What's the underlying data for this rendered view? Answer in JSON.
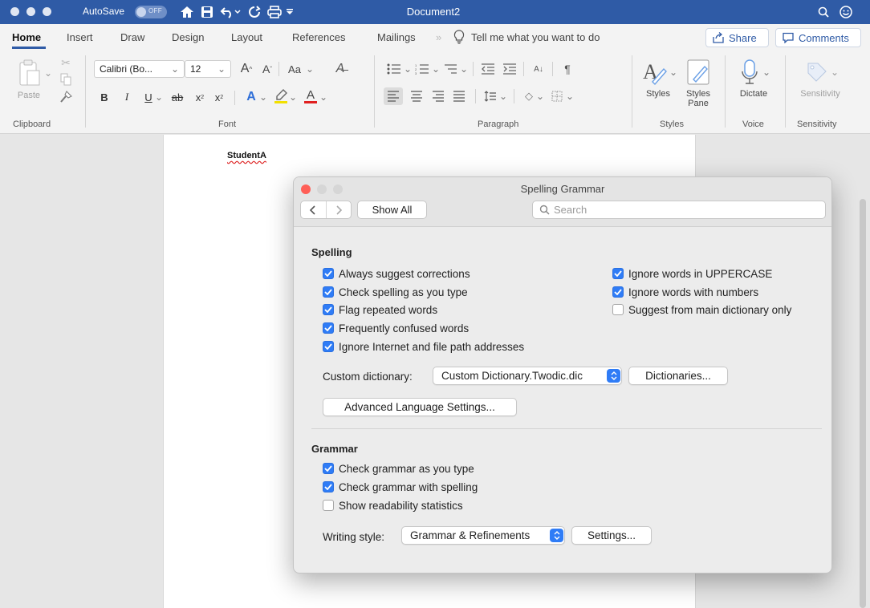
{
  "titlebar": {
    "autosave_label": "AutoSave",
    "autosave_state": "OFF",
    "document_title": "Document2",
    "bg_color": "#2f5ba6"
  },
  "tabs": [
    {
      "label": "Home",
      "active": true
    },
    {
      "label": "Insert"
    },
    {
      "label": "Draw"
    },
    {
      "label": "Design"
    },
    {
      "label": "Layout"
    },
    {
      "label": "References"
    },
    {
      "label": "Mailings"
    }
  ],
  "tell_me": "Tell me what you want to do",
  "share_label": "Share",
  "comments_label": "Comments",
  "ribbon": {
    "paste_label": "Paste",
    "font_name": "Calibri (Bo...",
    "font_size": "12",
    "change_case": "Aa",
    "styles_label": "Styles",
    "styles_pane_label": "Styles\nPane",
    "dictate_label": "Dictate",
    "sensitivity_label": "Sensitivity",
    "group_labels": {
      "clipboard": "Clipboard",
      "font": "Font",
      "paragraph": "Paragraph",
      "styles": "Styles",
      "voice": "Voice",
      "sensitivity": "Sensitivity"
    }
  },
  "document": {
    "text": "StudentA"
  },
  "dialog": {
    "title": "Spelling  Grammar",
    "show_all": "Show All",
    "search_placeholder": "Search",
    "spelling": {
      "heading": "Spelling",
      "left_options": [
        {
          "label": "Always suggest corrections",
          "checked": true
        },
        {
          "label": "Check spelling as you type",
          "checked": true
        },
        {
          "label": "Flag repeated words",
          "checked": true
        },
        {
          "label": "Frequently confused words",
          "checked": true
        },
        {
          "label": "Ignore Internet and file path addresses",
          "checked": true
        }
      ],
      "right_options": [
        {
          "label": "Ignore words in UPPERCASE",
          "checked": true
        },
        {
          "label": "Ignore words with numbers",
          "checked": true
        },
        {
          "label": "Suggest from main dictionary only",
          "checked": false
        }
      ],
      "custom_dictionary_label": "Custom dictionary:",
      "custom_dictionary_value": "Custom Dictionary.Twodic.dic",
      "dictionaries_button": "Dictionaries...",
      "advanced_button": "Advanced Language Settings..."
    },
    "grammar": {
      "heading": "Grammar",
      "options": [
        {
          "label": "Check grammar as you type",
          "checked": true
        },
        {
          "label": "Check grammar with spelling",
          "checked": true
        },
        {
          "label": "Show readability statistics",
          "checked": false
        }
      ],
      "writing_style_label": "Writing style:",
      "writing_style_value": "Grammar & Refinements",
      "settings_button": "Settings..."
    }
  },
  "colors": {
    "accent": "#2f5ba6",
    "checkbox_blue": "#2f7cf6",
    "close_red": "#ff5f57"
  }
}
